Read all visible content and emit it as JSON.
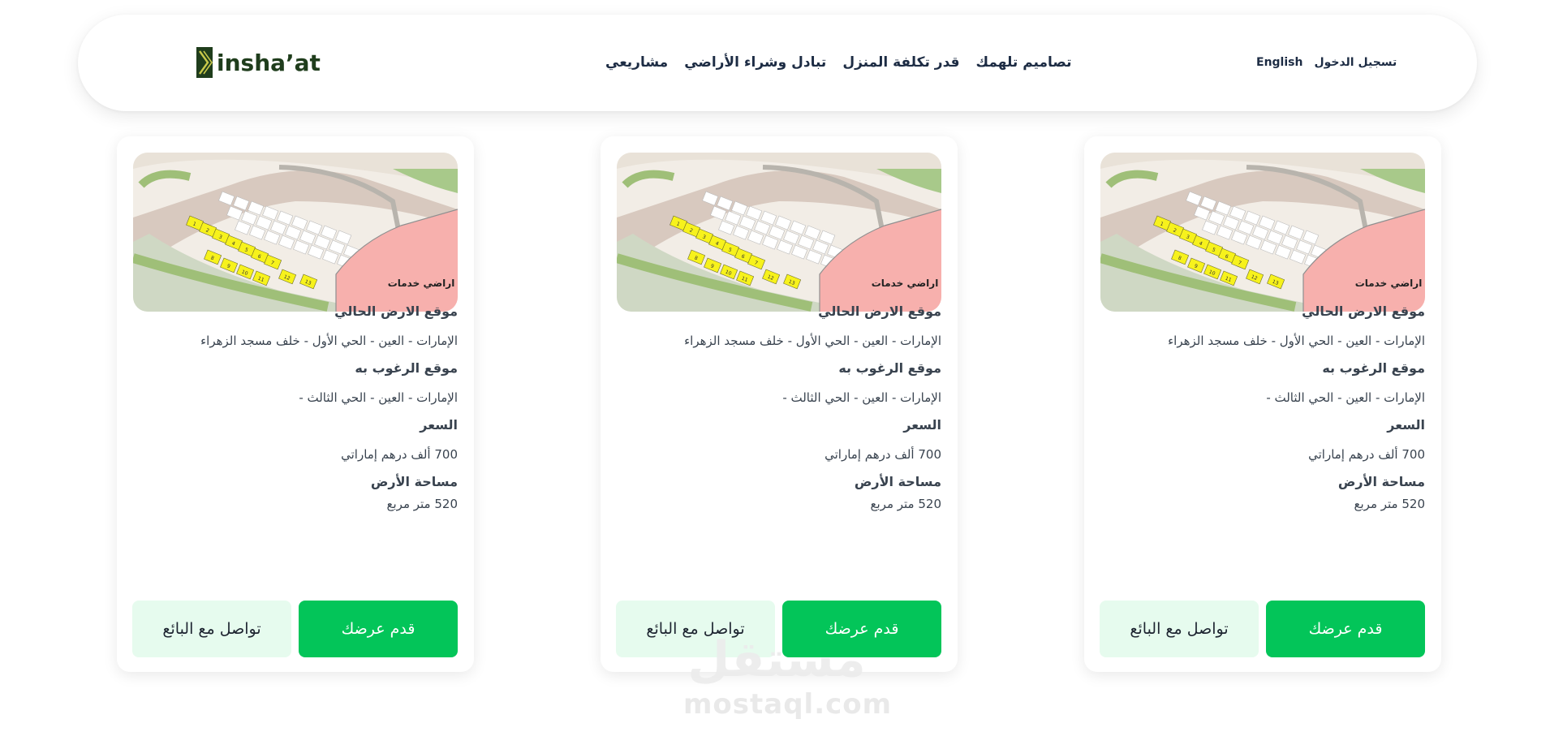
{
  "header": {
    "logo_text": "insha’at",
    "nav": [
      "مشاريعي",
      "تبادل وشراء الأراضي",
      "قدر تكلفة المنزل",
      "تصاميم تلهمك"
    ],
    "auth": {
      "english": "English",
      "login": "تسجيل الدخول"
    }
  },
  "colors": {
    "primary_green": "#03c559",
    "light_green": "#e6fbee",
    "logo_green": "#1f3d1c",
    "navy": "#1d2c44"
  },
  "map_image": {
    "overlay_text": "اراضي خدمات",
    "plot_numbers": [
      "1",
      "2",
      "3",
      "4",
      "5",
      "6",
      "7",
      "8",
      "9",
      "10",
      "11",
      "12",
      "13"
    ]
  },
  "cards": [
    {
      "current_location_label": "موقع الارض الحالي",
      "current_location": "الإمارات - العين - الحي الأول - خلف مسجد الزهراء",
      "desired_location_label": "موقع الرغوب به",
      "desired_location": "الإمارات - العين - الحي الثالث -",
      "price_label": "السعر",
      "price": "700 ألف درهم إماراتي",
      "area_label": "مساحة الأرض",
      "area": "520 متر مربع",
      "offer_button": "قدم عرضك",
      "contact_button": "تواصل مع البائع"
    },
    {
      "current_location_label": "موقع الارض الحالي",
      "current_location": "الإمارات - العين - الحي الأول - خلف مسجد الزهراء",
      "desired_location_label": "موقع الرغوب به",
      "desired_location": "الإمارات - العين - الحي الثالث -",
      "price_label": "السعر",
      "price": "700 ألف درهم إماراتي",
      "area_label": "مساحة الأرض",
      "area": "520 متر مربع",
      "offer_button": "قدم عرضك",
      "contact_button": "تواصل مع البائع"
    },
    {
      "current_location_label": "موقع الارض الحالي",
      "current_location": "الإمارات - العين - الحي الأول - خلف مسجد الزهراء",
      "desired_location_label": "موقع الرغوب به",
      "desired_location": "الإمارات - العين - الحي الثالث -",
      "price_label": "السعر",
      "price": "700 ألف درهم إماراتي",
      "area_label": "مساحة الأرض",
      "area": "520 متر مربع",
      "offer_button": "قدم عرضك",
      "contact_button": "تواصل مع البائع"
    }
  ],
  "watermark": {
    "arabic": "مستقل",
    "latin": "mostaql.com"
  }
}
